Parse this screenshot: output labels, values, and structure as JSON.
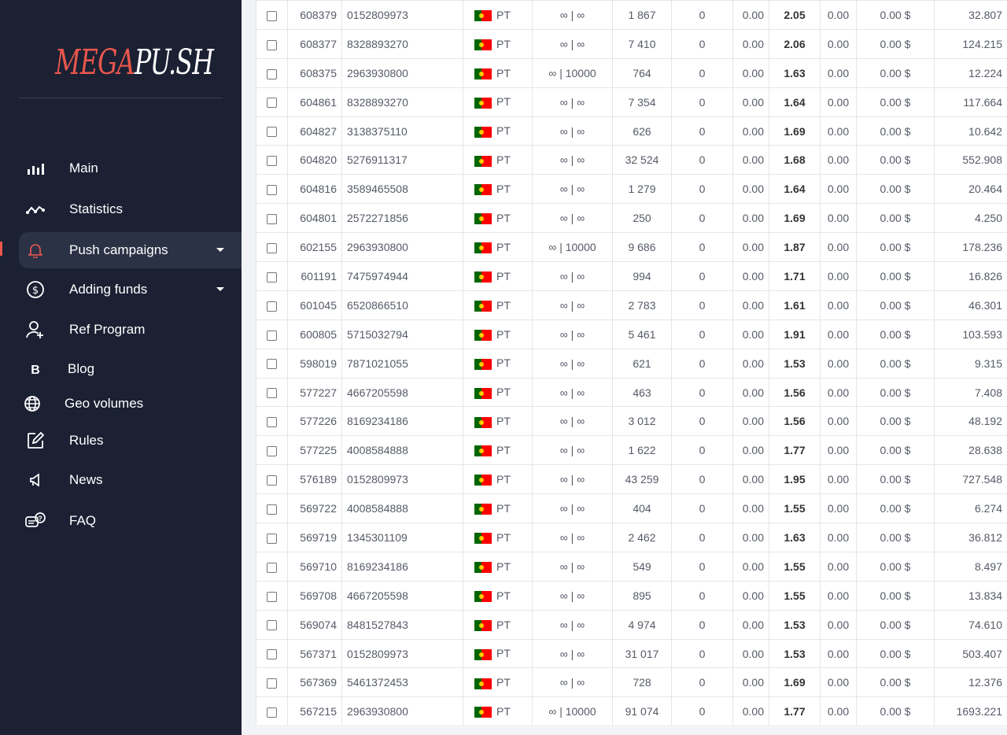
{
  "logo": {
    "part1": "MEGA",
    "part2": "PU.SH"
  },
  "nav": [
    {
      "label": "Main",
      "icon": "bar-chart-icon",
      "caret": false,
      "active": false
    },
    {
      "label": "Statistics",
      "icon": "line-chart-icon",
      "caret": false,
      "active": false
    },
    {
      "label": "Push campaigns",
      "icon": "bell-icon",
      "caret": true,
      "active": true
    },
    {
      "label": "Adding funds",
      "icon": "dollar-icon",
      "caret": true,
      "active": false
    },
    {
      "label": "Ref Program",
      "icon": "user-plus-icon",
      "caret": false,
      "active": false
    },
    {
      "label": "Blog",
      "icon": "blog-b-icon",
      "caret": false,
      "active": false
    },
    {
      "label": "Geo volumes",
      "icon": "globe-icon",
      "caret": false,
      "active": false
    },
    {
      "label": "Rules",
      "icon": "edit-icon",
      "caret": false,
      "active": false
    },
    {
      "label": "News",
      "icon": "megaphone-icon",
      "caret": false,
      "active": false
    },
    {
      "label": "FAQ",
      "icon": "faq-chat-icon",
      "caret": false,
      "active": false
    }
  ],
  "colors": {
    "sidebar": "#1b2033",
    "accent": "#e9574d",
    "active_bg": "#2c3246"
  },
  "table": {
    "rows": [
      [
        "608379",
        "0152809973",
        "PT",
        "∞ | ∞",
        "1 867",
        "0",
        "0.00",
        "2.05",
        "0.00",
        "0.00 $",
        "32.807"
      ],
      [
        "608377",
        "8328893270",
        "PT",
        "∞ | ∞",
        "7 410",
        "0",
        "0.00",
        "2.06",
        "0.00",
        "0.00 $",
        "124.215"
      ],
      [
        "608375",
        "2963930800",
        "PT",
        "∞ | 10000",
        "764",
        "0",
        "0.00",
        "1.63",
        "0.00",
        "0.00 $",
        "12.224"
      ],
      [
        "604861",
        "8328893270",
        "PT",
        "∞ | ∞",
        "7 354",
        "0",
        "0.00",
        "1.64",
        "0.00",
        "0.00 $",
        "117.664"
      ],
      [
        "604827",
        "3138375110",
        "PT",
        "∞ | ∞",
        "626",
        "0",
        "0.00",
        "1.69",
        "0.00",
        "0.00 $",
        "10.642"
      ],
      [
        "604820",
        "5276911317",
        "PT",
        "∞ | ∞",
        "32 524",
        "0",
        "0.00",
        "1.68",
        "0.00",
        "0.00 $",
        "552.908"
      ],
      [
        "604816",
        "3589465508",
        "PT",
        "∞ | ∞",
        "1 279",
        "0",
        "0.00",
        "1.64",
        "0.00",
        "0.00 $",
        "20.464"
      ],
      [
        "604801",
        "2572271856",
        "PT",
        "∞ | ∞",
        "250",
        "0",
        "0.00",
        "1.69",
        "0.00",
        "0.00 $",
        "4.250"
      ],
      [
        "602155",
        "2963930800",
        "PT",
        "∞ | 10000",
        "9 686",
        "0",
        "0.00",
        "1.87",
        "0.00",
        "0.00 $",
        "178.236"
      ],
      [
        "601191",
        "7475974944",
        "PT",
        "∞ | ∞",
        "994",
        "0",
        "0.00",
        "1.71",
        "0.00",
        "0.00 $",
        "16.826"
      ],
      [
        "601045",
        "6520866510",
        "PT",
        "∞ | ∞",
        "2 783",
        "0",
        "0.00",
        "1.61",
        "0.00",
        "0.00 $",
        "46.301"
      ],
      [
        "600805",
        "5715032794",
        "PT",
        "∞ | ∞",
        "5 461",
        "0",
        "0.00",
        "1.91",
        "0.00",
        "0.00 $",
        "103.593"
      ],
      [
        "598019",
        "7871021055",
        "PT",
        "∞ | ∞",
        "621",
        "0",
        "0.00",
        "1.53",
        "0.00",
        "0.00 $",
        "9.315"
      ],
      [
        "577227",
        "4667205598",
        "PT",
        "∞ | ∞",
        "463",
        "0",
        "0.00",
        "1.56",
        "0.00",
        "0.00 $",
        "7.408"
      ],
      [
        "577226",
        "8169234186",
        "PT",
        "∞ | ∞",
        "3 012",
        "0",
        "0.00",
        "1.56",
        "0.00",
        "0.00 $",
        "48.192"
      ],
      [
        "577225",
        "4008584888",
        "PT",
        "∞ | ∞",
        "1 622",
        "0",
        "0.00",
        "1.77",
        "0.00",
        "0.00 $",
        "28.638"
      ],
      [
        "576189",
        "0152809973",
        "PT",
        "∞ | ∞",
        "43 259",
        "0",
        "0.00",
        "1.95",
        "0.00",
        "0.00 $",
        "727.548"
      ],
      [
        "569722",
        "4008584888",
        "PT",
        "∞ | ∞",
        "404",
        "0",
        "0.00",
        "1.55",
        "0.00",
        "0.00 $",
        "6.274"
      ],
      [
        "569719",
        "1345301109",
        "PT",
        "∞ | ∞",
        "2 462",
        "0",
        "0.00",
        "1.63",
        "0.00",
        "0.00 $",
        "36.812"
      ],
      [
        "569710",
        "8169234186",
        "PT",
        "∞ | ∞",
        "549",
        "0",
        "0.00",
        "1.55",
        "0.00",
        "0.00 $",
        "8.497"
      ],
      [
        "569708",
        "4667205598",
        "PT",
        "∞ | ∞",
        "895",
        "0",
        "0.00",
        "1.55",
        "0.00",
        "0.00 $",
        "13.834"
      ],
      [
        "569074",
        "8481527843",
        "PT",
        "∞ | ∞",
        "4 974",
        "0",
        "0.00",
        "1.53",
        "0.00",
        "0.00 $",
        "74.610"
      ],
      [
        "567371",
        "0152809973",
        "PT",
        "∞ | ∞",
        "31 017",
        "0",
        "0.00",
        "1.53",
        "0.00",
        "0.00 $",
        "503.407"
      ],
      [
        "567369",
        "5461372453",
        "PT",
        "∞ | ∞",
        "728",
        "0",
        "0.00",
        "1.69",
        "0.00",
        "0.00 $",
        "12.376"
      ],
      [
        "567215",
        "2963930800",
        "PT",
        "∞ | 10000",
        "91 074",
        "0",
        "0.00",
        "1.77",
        "0.00",
        "0.00 $",
        "1693.221"
      ]
    ]
  }
}
